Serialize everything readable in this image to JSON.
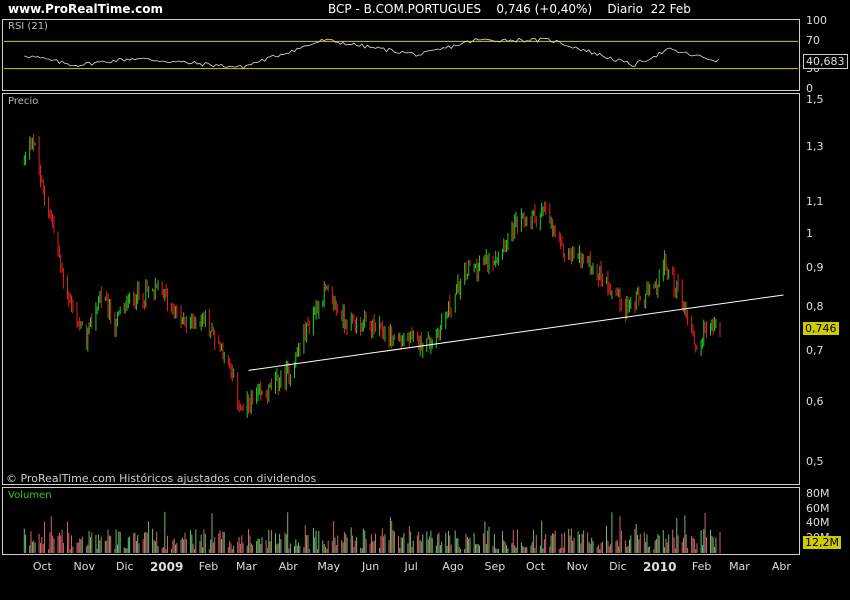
{
  "header": {
    "site": "www.ProRealTime.com",
    "title": "BCP - B.COM.PORTUGUES    0,746 (+0,40%)    Diario  22 Feb"
  },
  "panels": {
    "rsi_label": "RSI (21)",
    "price_label": "Precio",
    "volume_label": "Volumen",
    "footer": "© ProRealTime.com  Históricos ajustados con dividendos"
  },
  "axes": {
    "rsi_ticks": [
      "100",
      "70",
      "30",
      "0"
    ],
    "rsi_value": "40,683",
    "price_ticks": [
      "1,5",
      "1,3",
      "1,1",
      "1",
      "0,9",
      "0,8",
      "0,7",
      "0,6",
      "0,5"
    ],
    "price_value": "0,746",
    "volume_ticks": [
      "80M",
      "60M",
      "40M",
      "20M"
    ],
    "volume_value": "12,2M",
    "x_ticks": [
      "Oct",
      "Nov",
      "Dic",
      "2009",
      "Feb",
      "Mar",
      "Abr",
      "May",
      "Jun",
      "Jul",
      "Ago",
      "Sep",
      "Oct",
      "Nov",
      "Dic",
      "2010",
      "Feb",
      "Mar",
      "Abr"
    ]
  },
  "colors": {
    "up": "#22cc22",
    "down": "#dd2222",
    "rsi_band": "#cccc22",
    "trendline": "#ffffff",
    "badge_bg": "#cccc00"
  },
  "chart_data": {
    "type": "candlestick",
    "price_scale": "log",
    "ylim": [
      0.47,
      1.52
    ],
    "price_path": [
      {
        "date": "2008-09-25",
        "close": 1.25
      },
      {
        "date": "2008-10-01",
        "close": 1.35
      },
      {
        "date": "2008-10-08",
        "close": 1.15
      },
      {
        "date": "2008-10-15",
        "close": 1.05
      },
      {
        "date": "2008-10-22",
        "close": 0.9
      },
      {
        "date": "2008-10-30",
        "close": 0.8
      },
      {
        "date": "2008-11-10",
        "close": 0.72
      },
      {
        "date": "2008-11-20",
        "close": 0.83
      },
      {
        "date": "2008-12-01",
        "close": 0.76
      },
      {
        "date": "2008-12-15",
        "close": 0.83
      },
      {
        "date": "2009-01-05",
        "close": 0.84
      },
      {
        "date": "2009-01-20",
        "close": 0.76
      },
      {
        "date": "2009-02-05",
        "close": 0.77
      },
      {
        "date": "2009-02-20",
        "close": 0.7
      },
      {
        "date": "2009-03-05",
        "close": 0.58
      },
      {
        "date": "2009-03-12",
        "close": 0.6
      },
      {
        "date": "2009-03-25",
        "close": 0.62
      },
      {
        "date": "2009-04-10",
        "close": 0.66
      },
      {
        "date": "2009-04-25",
        "close": 0.77
      },
      {
        "date": "2009-05-05",
        "close": 0.84
      },
      {
        "date": "2009-05-20",
        "close": 0.77
      },
      {
        "date": "2009-06-10",
        "close": 0.75
      },
      {
        "date": "2009-06-25",
        "close": 0.73
      },
      {
        "date": "2009-07-10",
        "close": 0.72
      },
      {
        "date": "2009-07-25",
        "close": 0.72
      },
      {
        "date": "2009-08-10",
        "close": 0.83
      },
      {
        "date": "2009-08-20",
        "close": 0.9
      },
      {
        "date": "2009-09-05",
        "close": 0.92
      },
      {
        "date": "2009-09-25",
        "close": 1.03
      },
      {
        "date": "2009-10-15",
        "close": 1.07
      },
      {
        "date": "2009-10-28",
        "close": 0.95
      },
      {
        "date": "2009-11-15",
        "close": 0.92
      },
      {
        "date": "2009-12-01",
        "close": 0.86
      },
      {
        "date": "2009-12-15",
        "close": 0.8
      },
      {
        "date": "2010-01-05",
        "close": 0.84
      },
      {
        "date": "2010-01-12",
        "close": 0.91
      },
      {
        "date": "2010-01-25",
        "close": 0.82
      },
      {
        "date": "2010-02-05",
        "close": 0.7
      },
      {
        "date": "2010-02-12",
        "close": 0.76
      },
      {
        "date": "2010-02-22",
        "close": 0.746
      }
    ],
    "trendline": [
      {
        "date": "2009-03-10",
        "price": 0.66
      },
      {
        "date": "2010-04-10",
        "price": 0.83
      }
    ],
    "rsi_path": [
      {
        "date": "2008-09-25",
        "rsi": 50
      },
      {
        "date": "2008-11-01",
        "rsi": 35
      },
      {
        "date": "2008-12-15",
        "rsi": 45
      },
      {
        "date": "2009-03-05",
        "rsi": 32
      },
      {
        "date": "2009-05-05",
        "rsi": 72
      },
      {
        "date": "2009-07-15",
        "rsi": 50
      },
      {
        "date": "2009-08-25",
        "rsi": 72
      },
      {
        "date": "2009-10-20",
        "rsi": 72
      },
      {
        "date": "2009-12-20",
        "rsi": 35
      },
      {
        "date": "2010-01-15",
        "rsi": 58
      },
      {
        "date": "2010-02-22",
        "rsi": 40.683
      }
    ],
    "rsi_ylim": [
      0,
      100
    ],
    "rsi_bands": [
      30,
      70
    ],
    "volume_ylim": [
      0,
      85
    ]
  }
}
